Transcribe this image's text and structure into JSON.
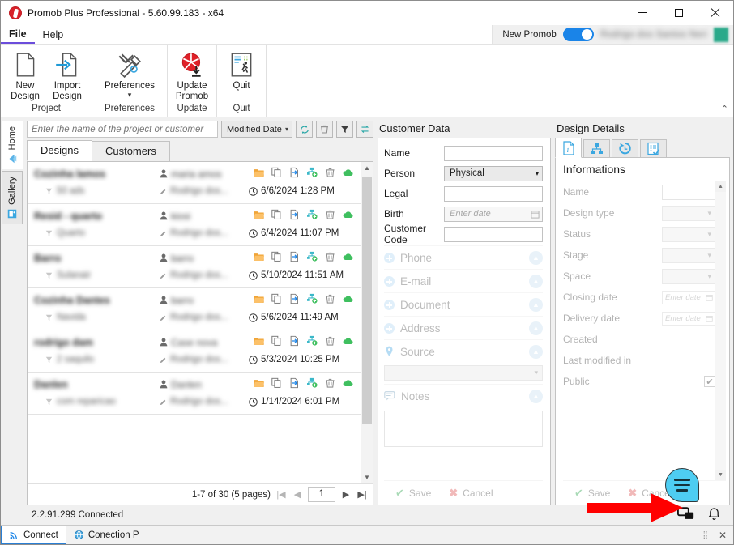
{
  "window": {
    "title": "Promob Plus Professional - 5.60.99.183 - x64",
    "logo_icon": "promob-logo-icon",
    "minimize_icon": "minimize-icon",
    "maximize_icon": "maximize-icon",
    "close_icon": "close-icon"
  },
  "menubar": {
    "items": [
      {
        "label": "File",
        "active": true
      },
      {
        "label": "Help",
        "active": false
      }
    ],
    "new_promob_label": "New Promob",
    "new_promob_toggle": "on",
    "user_name": "Rodrigo dos Santos Neri",
    "avatar_color": "#2aa98a",
    "toggle_color": "#1a84e8"
  },
  "ribbon": {
    "collapse_icon": "chevron-up-icon",
    "groups": [
      {
        "title": "Project",
        "buttons": [
          {
            "label": "New\nDesign",
            "label1": "New",
            "label2": "Design",
            "icon": "new-document-icon"
          },
          {
            "label": "Import\nDesign",
            "label1": "Import",
            "label2": "Design",
            "icon": "import-document-icon"
          }
        ]
      },
      {
        "title": "Preferences",
        "buttons": [
          {
            "label1": "Preferences",
            "label2": "",
            "icon": "tools-icon",
            "has_chevron": true
          }
        ]
      },
      {
        "title": "Update",
        "buttons": [
          {
            "label1": "Update",
            "label2": "Promob",
            "icon": "update-promob-icon"
          }
        ]
      },
      {
        "title": "Quit",
        "buttons": [
          {
            "label1": "Quit",
            "label2": "",
            "icon": "quit-icon"
          }
        ]
      }
    ]
  },
  "vertical_tabs": [
    {
      "label": "Home",
      "icon": "home-arrow-icon",
      "selected": false
    },
    {
      "label": "Gallery",
      "icon": "gallery-icon",
      "selected": true
    }
  ],
  "list_panel": {
    "search_placeholder": "Enter the name of the project or customer",
    "search_value": "",
    "sort_label": "Modified Date",
    "toolbar_buttons": [
      {
        "name": "refresh-icon",
        "title": "Refresh"
      },
      {
        "name": "trash-icon",
        "title": "Delete"
      },
      {
        "name": "filter-icon",
        "title": "Filter"
      },
      {
        "name": "swap-icon",
        "title": "Sort order"
      }
    ],
    "tabs": [
      {
        "label": "Designs",
        "selected": true
      },
      {
        "label": "Customers",
        "selected": false
      }
    ],
    "row_actions": [
      "open-folder-icon",
      "copy-icon",
      "export-icon",
      "share-icon",
      "delete-icon",
      "cloud-icon"
    ],
    "rows": [
      {
        "title": "Cozinha lamos",
        "owner": "maria amos",
        "tag": "50 ads",
        "editor": "Rodrigo dos...",
        "date": "6/6/2024 1:28 PM"
      },
      {
        "title": "Resid - quarto",
        "owner": "kiosi",
        "tag": "Quarto",
        "editor": "Rodrigo dos...",
        "date": "6/4/2024 11:07 PM"
      },
      {
        "title": "Barro",
        "owner": "barro",
        "tag": "Sulanair",
        "editor": "Rodrigo dos...",
        "date": "5/10/2024 11:51 AM"
      },
      {
        "title": "Cozinha Dantes",
        "owner": "barro",
        "tag": "Navida",
        "editor": "Rodrigo dos...",
        "date": "5/6/2024 11:49 AM"
      },
      {
        "title": "rodrigo dam",
        "owner": "Case nova",
        "tag": "2 saquilo",
        "editor": "Rodrigo dos...",
        "date": "5/3/2024 10:25 PM"
      },
      {
        "title": "Danlen",
        "owner": "Danlen",
        "tag": "com reparicao",
        "editor": "Rodrigo dos...",
        "date": "1/14/2024 6:01 PM"
      }
    ],
    "pager": {
      "summary": "1-7 of 30 (5 pages)",
      "first_icon": "first-page-icon",
      "prev_icon": "prev-page-icon",
      "page_value": "1",
      "next_icon": "next-page-icon",
      "last_icon": "last-page-icon"
    },
    "scroll_up_icon": "scroll-up-icon",
    "scroll_down_icon": "scroll-down-icon"
  },
  "customer_panel": {
    "title": "Customer Data",
    "fields": [
      {
        "label": "Name",
        "type": "text",
        "value": ""
      },
      {
        "label": "Person",
        "type": "select",
        "value": "Physical"
      },
      {
        "label": "Legal",
        "type": "text",
        "value": ""
      },
      {
        "label": "Birth",
        "type": "date",
        "placeholder": "Enter date"
      },
      {
        "label": "Customer Code",
        "type": "text",
        "value": ""
      }
    ],
    "sections": [
      {
        "label": "Phone",
        "icon": "plus-circle-icon",
        "collapse_icon": "chevron-up-circle-icon"
      },
      {
        "label": "E-mail",
        "icon": "plus-circle-icon",
        "collapse_icon": "chevron-up-circle-icon"
      },
      {
        "label": "Document",
        "icon": "plus-circle-icon",
        "collapse_icon": "chevron-up-circle-icon"
      },
      {
        "label": "Address",
        "icon": "plus-circle-icon",
        "collapse_icon": "chevron-up-circle-icon"
      },
      {
        "label": "Source",
        "icon": "pin-icon",
        "collapse_icon": "chevron-up-circle-icon"
      },
      {
        "label": "Notes",
        "icon": "note-icon",
        "collapse_icon": "chevron-up-circle-icon"
      }
    ],
    "source_value": "",
    "notes_value": "",
    "save_label": "Save",
    "cancel_label": "Cancel"
  },
  "design_details": {
    "title": "Design Details",
    "tabs": [
      {
        "icon": "info-icon",
        "selected": true
      },
      {
        "icon": "hierarchy-icon",
        "selected": false
      },
      {
        "icon": "history-icon",
        "selected": false
      },
      {
        "icon": "checklist-icon",
        "selected": false
      }
    ],
    "heading": "Informations",
    "fields": [
      {
        "label": "Name",
        "type": "text",
        "value": ""
      },
      {
        "label": "Design type",
        "type": "select",
        "value": ""
      },
      {
        "label": "Status",
        "type": "select",
        "value": ""
      },
      {
        "label": "Stage",
        "type": "select",
        "value": ""
      },
      {
        "label": "Space",
        "type": "select",
        "value": ""
      },
      {
        "label": "Closing date",
        "type": "date",
        "placeholder": "Enter date"
      },
      {
        "label": "Delivery date",
        "type": "date",
        "placeholder": "Enter date"
      }
    ],
    "meta": [
      {
        "label": "Created",
        "value": ""
      },
      {
        "label": "Last modified in",
        "value": ""
      }
    ],
    "public_label": "Public",
    "public_checked": true,
    "save_label": "Save",
    "cancel_label": "Cancel",
    "scroll_up_icon": "scroll-up-icon",
    "scroll_down_icon": "scroll-down-icon"
  },
  "statusbar": {
    "version_status": "2.2.91.299 Connected",
    "chat_icon": "chat-screens-icon",
    "bell_icon": "notification-bell-icon"
  },
  "taskbar": {
    "items": [
      {
        "label": "Connect",
        "icon": "signal-icon",
        "selected": true
      },
      {
        "label": "Conection P",
        "icon": "globe-icon",
        "selected": false
      }
    ],
    "grip_icon": "resize-grip-icon",
    "close_icon": "close-small-icon"
  },
  "overlay": {
    "bubble_icon": "menu-bubble-icon",
    "bubble_color": "#4ecdf2",
    "arrow_icon": "red-arrow-icon",
    "arrow_color": "#ff0000"
  }
}
